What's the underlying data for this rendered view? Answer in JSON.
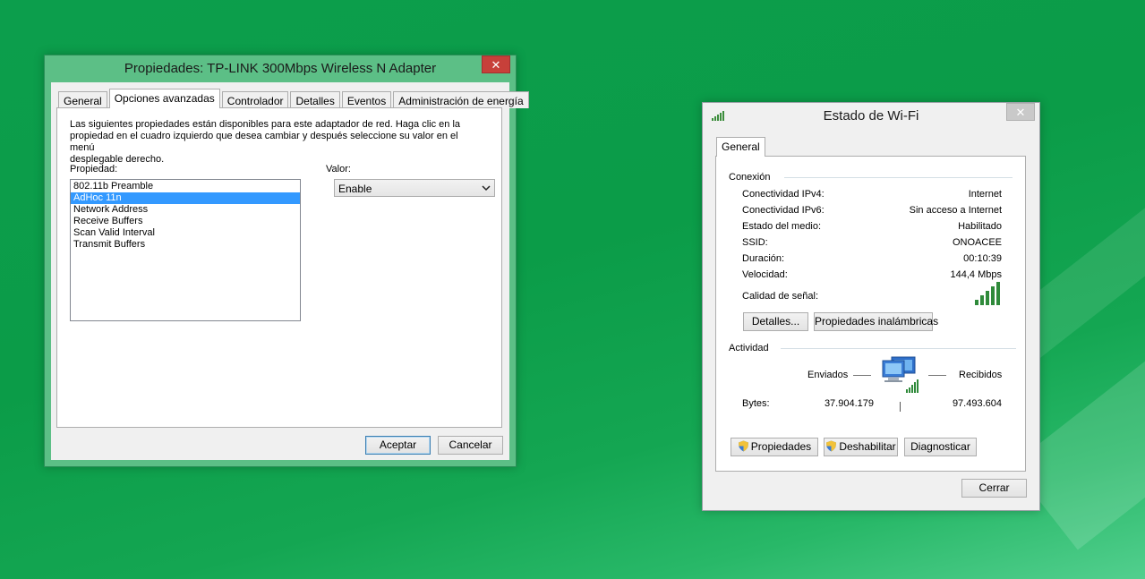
{
  "props_window": {
    "title": "Propiedades: TP-LINK 300Mbps Wireless N Adapter",
    "close_label": "✕",
    "tabs": [
      {
        "label": "General"
      },
      {
        "label": "Opciones avanzadas"
      },
      {
        "label": "Controlador"
      },
      {
        "label": "Detalles"
      },
      {
        "label": "Eventos"
      },
      {
        "label": "Administración de energía"
      }
    ],
    "active_tab": "Opciones avanzadas",
    "description_lines": [
      "Las siguientes propiedades están disponibles para este adaptador de red. Haga clic en la",
      "propiedad en el cuadro izquierdo que desea cambiar y después seleccione su valor en el menú",
      "desplegable derecho."
    ],
    "property_label": "Propiedad:",
    "value_label": "Valor:",
    "properties": [
      "802.11b Preamble",
      "AdHoc 11n",
      "Network Address",
      "Receive Buffers",
      "Scan Valid Interval",
      "Transmit Buffers"
    ],
    "selected_property": "AdHoc 11n",
    "value_selected": "Enable",
    "ok_label": "Aceptar",
    "cancel_label": "Cancelar"
  },
  "wifi_window": {
    "title": "Estado de Wi-Fi",
    "close_label": "✕",
    "tab_label": "General",
    "connection_group": "Conexión",
    "rows": [
      {
        "label": "Conectividad IPv4:",
        "value": "Internet"
      },
      {
        "label": "Conectividad IPv6:",
        "value": "Sin acceso a Internet"
      },
      {
        "label": "Estado del medio:",
        "value": "Habilitado"
      },
      {
        "label": "SSID:",
        "value": "ONOACEE"
      },
      {
        "label": "Duración:",
        "value": "00:10:39"
      },
      {
        "label": "Velocidad:",
        "value": "144,4 Mbps"
      }
    ],
    "signal_label": "Calidad de señal:",
    "signal_bars_lit": 5,
    "signal_bars_total": 5,
    "details_label": "Detalles...",
    "wireless_props_label": "Propiedades inalámbricas",
    "activity_group": "Actividad",
    "sent_label": "Enviados",
    "received_label": "Recibidos",
    "bytes_label": "Bytes:",
    "bytes_sent": "37.904.179",
    "bytes_received": "97.493.604",
    "properties_label": "Propiedades",
    "disable_label": "Deshabilitar",
    "diagnose_label": "Diagnosticar",
    "close_button_label": "Cerrar"
  },
  "colors": {
    "accent_green": "#0c9e4c",
    "selection_blue": "#3399ff",
    "signal_green": "#2f8a3a",
    "close_red": "#c7403a"
  },
  "icons": [
    "signal-icon",
    "network-activity-icon",
    "shield-icon",
    "chevron-down-icon",
    "close-icon"
  ]
}
